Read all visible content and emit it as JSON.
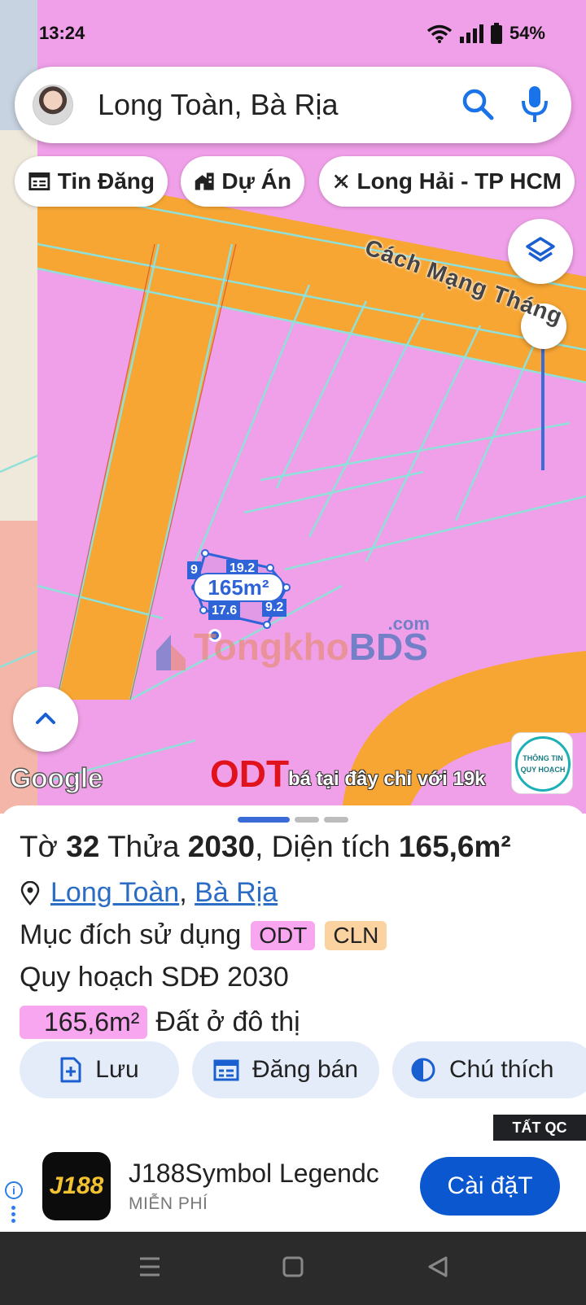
{
  "status_bar": {
    "time": "13:24",
    "battery": "54%"
  },
  "search": {
    "query": "Long Toàn, Bà Rịa"
  },
  "chips": [
    {
      "label": "Tin Đăng",
      "icon": "listing-icon"
    },
    {
      "label": "Dự Án",
      "icon": "building-icon"
    },
    {
      "label": "Long Hải - TP HCM",
      "icon": "route-icon"
    }
  ],
  "map": {
    "road_label": "Cách Mạng Tháng",
    "parcel": {
      "area_label": "165m²",
      "dims": [
        "9",
        "19.2",
        "17.6",
        "9.2"
      ]
    },
    "watermark": {
      "part1": "Tongkho",
      "part2": "BDS",
      "suffix": ".com"
    },
    "google": "Google",
    "zone_label": "ODT",
    "promo": "bá tại đây chỉ với 19k",
    "badge": {
      "line1": "THÔNG TIN",
      "line2": "QUY HOẠCH"
    },
    "colors": {
      "residential": "#f0a0e8",
      "road": "#f7a634",
      "boundary": "#8fe0d8"
    }
  },
  "sheet": {
    "title": {
      "to_label": "Tờ",
      "to_value": "32",
      "thua_label": "Thửa",
      "thua_value": "2030",
      "area_label": ", Diện tích",
      "area_value": "165,6m²"
    },
    "location": {
      "ward": "Long Toàn",
      "sep": ",",
      "city": "Bà Rịa"
    },
    "purpose_label": "Mục đích sử dụng",
    "purpose_tags": [
      "ODT",
      "CLN"
    ],
    "plan_label": "Quy hoạch SDĐ 2030",
    "land": {
      "area": "165,6m²",
      "type": "Đất ở đô thị"
    },
    "actions": [
      "Lưu",
      "Đăng bán",
      "Chú thích"
    ]
  },
  "ad": {
    "close_tag": "TẤT QC",
    "icon_text": "J188",
    "title": "J188Symbol Legendc",
    "subtitle": "MIỄN PHÍ",
    "cta": "Cài đặT"
  }
}
